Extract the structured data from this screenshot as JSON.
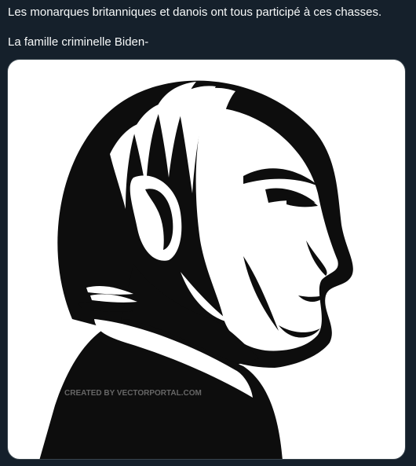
{
  "tweet": {
    "line1": "Les monarques britanniques et danois ont tous participé à ces chasses.",
    "line2": "La famille criminelle Biden-"
  },
  "media": {
    "watermark": "CREATED BY VECTORPORTAL.COM",
    "background": "#ffffff",
    "ink": "#0d0d0d"
  },
  "colors": {
    "page_background": "#15202b",
    "text": "#f7f9f9"
  }
}
